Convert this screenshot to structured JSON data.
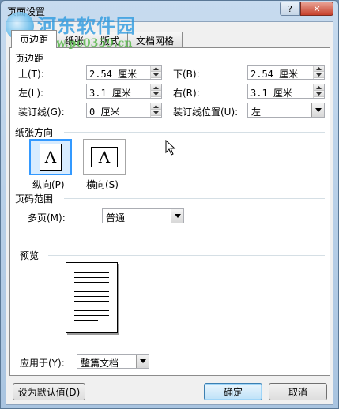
{
  "window": {
    "title": "页面设置"
  },
  "watermark": {
    "site_name": "河东软件园",
    "url": "www.pc0359.cn"
  },
  "tabs": [
    "页边距",
    "纸张",
    "版式",
    "文档网格"
  ],
  "margins": {
    "group_label": "页边距",
    "top": {
      "label": "上(T):",
      "value": "2.54 厘米"
    },
    "bottom": {
      "label": "下(B):",
      "value": "2.54 厘米"
    },
    "left": {
      "label": "左(L):",
      "value": "3.1 厘米"
    },
    "right": {
      "label": "右(R):",
      "value": "3.1 厘米"
    },
    "gutter": {
      "label": "装订线(G):",
      "value": "0 厘米"
    },
    "gutter_position": {
      "label": "装订线位置(U):",
      "value": "左"
    }
  },
  "orientation": {
    "group_label": "纸张方向",
    "portrait_label": "纵向(P)",
    "landscape_label": "横向(S)",
    "glyph": "A",
    "selected": "portrait"
  },
  "pages": {
    "group_label": "页码范围",
    "multiple_label": "多页(M):",
    "multiple_value": "普通"
  },
  "preview": {
    "group_label": "预览",
    "apply_label": "应用于(Y):",
    "apply_value": "整篇文档"
  },
  "buttons": {
    "set_default": "设为默认值(D)",
    "ok": "确定",
    "cancel": "取消"
  },
  "icons": {
    "help": "?",
    "close": "✕",
    "dropdown": "▼",
    "spin_up": "▲",
    "spin_down": "▼"
  }
}
